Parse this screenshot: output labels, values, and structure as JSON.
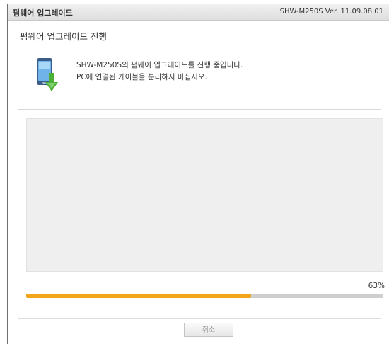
{
  "window": {
    "title": "펌웨어 업그레이드",
    "version_info": "SHW-M250S Ver. 11.09.08.01"
  },
  "panel": {
    "heading": "펌웨어 업그레이드 진행",
    "message_line1": "SHW-M250S의 펌웨어 업그레이드를 진행 중입니다.",
    "message_line2": "PC에 연결된 케이블을 분리하지 마십시오.",
    "icon": "phone-download-icon"
  },
  "progress": {
    "value": 63,
    "label": "63%",
    "fill_color": "#f2a51a",
    "track_color": "#cfcfcf"
  },
  "buttons": {
    "cancel_label": "취소"
  }
}
